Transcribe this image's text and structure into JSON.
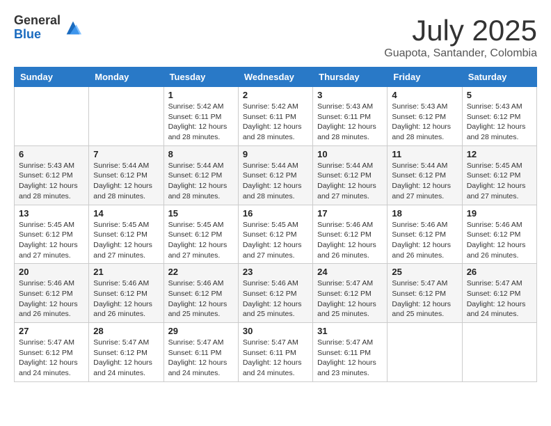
{
  "logo": {
    "general": "General",
    "blue": "Blue"
  },
  "title": "July 2025",
  "location": "Guapota, Santander, Colombia",
  "days_of_week": [
    "Sunday",
    "Monday",
    "Tuesday",
    "Wednesday",
    "Thursday",
    "Friday",
    "Saturday"
  ],
  "weeks": [
    [
      {
        "day": "",
        "info": ""
      },
      {
        "day": "",
        "info": ""
      },
      {
        "day": "1",
        "info": "Sunrise: 5:42 AM\nSunset: 6:11 PM\nDaylight: 12 hours and 28 minutes."
      },
      {
        "day": "2",
        "info": "Sunrise: 5:42 AM\nSunset: 6:11 PM\nDaylight: 12 hours and 28 minutes."
      },
      {
        "day": "3",
        "info": "Sunrise: 5:43 AM\nSunset: 6:11 PM\nDaylight: 12 hours and 28 minutes."
      },
      {
        "day": "4",
        "info": "Sunrise: 5:43 AM\nSunset: 6:12 PM\nDaylight: 12 hours and 28 minutes."
      },
      {
        "day": "5",
        "info": "Sunrise: 5:43 AM\nSunset: 6:12 PM\nDaylight: 12 hours and 28 minutes."
      }
    ],
    [
      {
        "day": "6",
        "info": "Sunrise: 5:43 AM\nSunset: 6:12 PM\nDaylight: 12 hours and 28 minutes."
      },
      {
        "day": "7",
        "info": "Sunrise: 5:44 AM\nSunset: 6:12 PM\nDaylight: 12 hours and 28 minutes."
      },
      {
        "day": "8",
        "info": "Sunrise: 5:44 AM\nSunset: 6:12 PM\nDaylight: 12 hours and 28 minutes."
      },
      {
        "day": "9",
        "info": "Sunrise: 5:44 AM\nSunset: 6:12 PM\nDaylight: 12 hours and 28 minutes."
      },
      {
        "day": "10",
        "info": "Sunrise: 5:44 AM\nSunset: 6:12 PM\nDaylight: 12 hours and 27 minutes."
      },
      {
        "day": "11",
        "info": "Sunrise: 5:44 AM\nSunset: 6:12 PM\nDaylight: 12 hours and 27 minutes."
      },
      {
        "day": "12",
        "info": "Sunrise: 5:45 AM\nSunset: 6:12 PM\nDaylight: 12 hours and 27 minutes."
      }
    ],
    [
      {
        "day": "13",
        "info": "Sunrise: 5:45 AM\nSunset: 6:12 PM\nDaylight: 12 hours and 27 minutes."
      },
      {
        "day": "14",
        "info": "Sunrise: 5:45 AM\nSunset: 6:12 PM\nDaylight: 12 hours and 27 minutes."
      },
      {
        "day": "15",
        "info": "Sunrise: 5:45 AM\nSunset: 6:12 PM\nDaylight: 12 hours and 27 minutes."
      },
      {
        "day": "16",
        "info": "Sunrise: 5:45 AM\nSunset: 6:12 PM\nDaylight: 12 hours and 27 minutes."
      },
      {
        "day": "17",
        "info": "Sunrise: 5:46 AM\nSunset: 6:12 PM\nDaylight: 12 hours and 26 minutes."
      },
      {
        "day": "18",
        "info": "Sunrise: 5:46 AM\nSunset: 6:12 PM\nDaylight: 12 hours and 26 minutes."
      },
      {
        "day": "19",
        "info": "Sunrise: 5:46 AM\nSunset: 6:12 PM\nDaylight: 12 hours and 26 minutes."
      }
    ],
    [
      {
        "day": "20",
        "info": "Sunrise: 5:46 AM\nSunset: 6:12 PM\nDaylight: 12 hours and 26 minutes."
      },
      {
        "day": "21",
        "info": "Sunrise: 5:46 AM\nSunset: 6:12 PM\nDaylight: 12 hours and 26 minutes."
      },
      {
        "day": "22",
        "info": "Sunrise: 5:46 AM\nSunset: 6:12 PM\nDaylight: 12 hours and 25 minutes."
      },
      {
        "day": "23",
        "info": "Sunrise: 5:46 AM\nSunset: 6:12 PM\nDaylight: 12 hours and 25 minutes."
      },
      {
        "day": "24",
        "info": "Sunrise: 5:47 AM\nSunset: 6:12 PM\nDaylight: 12 hours and 25 minutes."
      },
      {
        "day": "25",
        "info": "Sunrise: 5:47 AM\nSunset: 6:12 PM\nDaylight: 12 hours and 25 minutes."
      },
      {
        "day": "26",
        "info": "Sunrise: 5:47 AM\nSunset: 6:12 PM\nDaylight: 12 hours and 24 minutes."
      }
    ],
    [
      {
        "day": "27",
        "info": "Sunrise: 5:47 AM\nSunset: 6:12 PM\nDaylight: 12 hours and 24 minutes."
      },
      {
        "day": "28",
        "info": "Sunrise: 5:47 AM\nSunset: 6:12 PM\nDaylight: 12 hours and 24 minutes."
      },
      {
        "day": "29",
        "info": "Sunrise: 5:47 AM\nSunset: 6:11 PM\nDaylight: 12 hours and 24 minutes."
      },
      {
        "day": "30",
        "info": "Sunrise: 5:47 AM\nSunset: 6:11 PM\nDaylight: 12 hours and 24 minutes."
      },
      {
        "day": "31",
        "info": "Sunrise: 5:47 AM\nSunset: 6:11 PM\nDaylight: 12 hours and 23 minutes."
      },
      {
        "day": "",
        "info": ""
      },
      {
        "day": "",
        "info": ""
      }
    ]
  ]
}
